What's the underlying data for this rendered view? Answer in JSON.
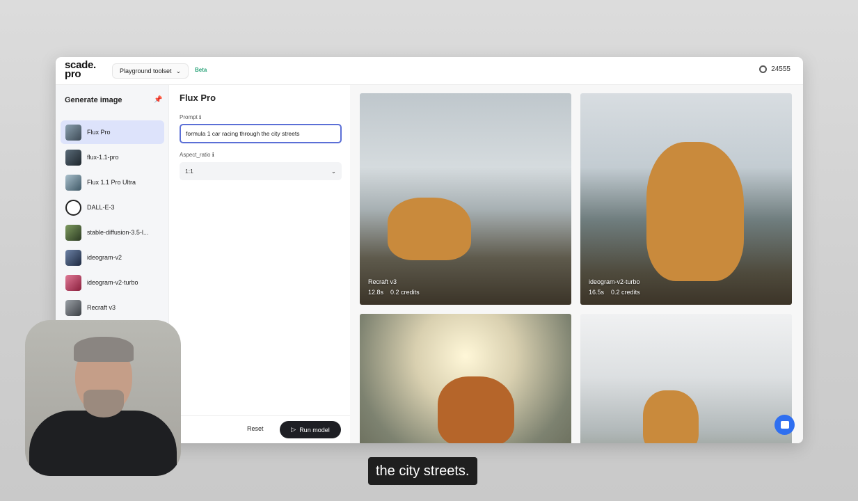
{
  "header": {
    "logo_line1": "scade.",
    "logo_line2": "pro",
    "toolset_label": "Playground toolset",
    "beta_badge": "Beta",
    "credits": "24555"
  },
  "sidebar": {
    "title": "Generate image",
    "items": [
      {
        "label": "Flux Pro",
        "active": true,
        "color": "#5a6a78"
      },
      {
        "label": "flux-1.1-pro",
        "active": false,
        "color": "#39434d"
      },
      {
        "label": "Flux 1.1 Pro Ultra",
        "active": false,
        "color": "#6f8a99"
      },
      {
        "label": "DALL-E-3",
        "active": false,
        "color": "#ffffff"
      },
      {
        "label": "stable-diffusion-3.5-l...",
        "active": false,
        "color": "#4f6b3e"
      },
      {
        "label": "ideogram-v2",
        "active": false,
        "color": "#2f3f5a"
      },
      {
        "label": "ideogram-v2-turbo",
        "active": false,
        "color": "#c24060"
      },
      {
        "label": "Recraft v3",
        "active": false,
        "color": "#6b6f75"
      }
    ]
  },
  "form": {
    "title": "Flux Pro",
    "prompt_label": "Prompt",
    "prompt_value": "formula 1 car racing through the city streets",
    "aspect_label": "Aspect_ratio",
    "aspect_value": "1:1",
    "reset_label": "Reset",
    "run_label": "Run model"
  },
  "gallery": [
    {
      "model": "Recraft v3",
      "time": "12.8s",
      "credits": "0.2 credits"
    },
    {
      "model": "ideogram-v2-turbo",
      "time": "16.5s",
      "credits": "0.2 credits"
    },
    {
      "model": "",
      "time": "",
      "credits": ""
    },
    {
      "model": "",
      "time": "",
      "credits": ""
    }
  ],
  "subtitle": "the city streets.",
  "colors": {
    "accent": "#5b6fd6",
    "active_bg": "#dde3fb",
    "run_button": "#1e1f24",
    "chat_button": "#2f6ff0"
  }
}
